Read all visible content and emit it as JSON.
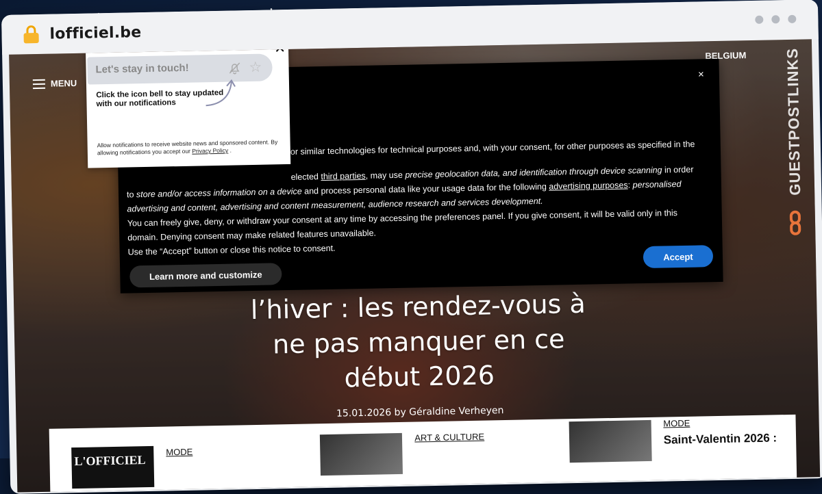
{
  "browser": {
    "url": "lofficiel.be",
    "window_dot_colors": [
      "#b7bbc2",
      "#b7bbc2",
      "#b7bbc2"
    ]
  },
  "site": {
    "menu_label": "MENU",
    "region": "BELGIUM"
  },
  "hero": {
    "title_lines": [
      "l’hiver : les rendez-vous à",
      "ne pas manquer en ce",
      "début 2026"
    ],
    "meta": "15.01.2026 by Géraldine Verheyen"
  },
  "consent": {
    "close_label": "×",
    "line_1": "or similar technologies for technical purposes and, with your consent, for other purposes as specified in the",
    "line_2_a": "elected ",
    "line_2_link": "third parties",
    "line_2_b": ", may use ",
    "line_2_italic": "precise geolocation data, and identification through device scanning",
    "line_2_c": " in order",
    "line_3_a": "to ",
    "line_3_italic": "store and/or access information on a device",
    "line_3_b": " and process personal data like your usage data for the following ",
    "line_3_link": "advertising purposes",
    "line_3_c": ": ",
    "line_3_italic_2": "personalised",
    "line_4_italic": "advertising and content, advertising and content measurement, audience research and services development.",
    "line_5": "You can freely give, deny, or withdraw your consent at any time by accessing the preferences panel. If you give consent, it will be valid only in this",
    "line_6": "domain. Denying consent may make related features unavailable.",
    "line_7": "Use the “Accept” button or close this notice to consent.",
    "learn_more_label": "Learn more and customize",
    "accept_label": "Accept",
    "accept_color": "#1a6fd1"
  },
  "notification": {
    "close_label": "✕",
    "title": "Let's stay in touch!",
    "body": "Click the icon bell to stay updated with our notifications",
    "footer": "Allow notifications to receive website news and sponsored content. By allowing notifications you accept our ",
    "footer_link": "Privacy Policy",
    "footer_end": " .",
    "icons": [
      "bell-off-icon",
      "star-icon"
    ]
  },
  "watermark": {
    "text": "GUESTPOSTLINKS",
    "accent_color": "#e8743b"
  },
  "cards": [
    {
      "category": "MODE",
      "title": "",
      "thumb_text": "L'OFFICIEL"
    },
    {
      "category": "ART & CULTURE",
      "title": ""
    },
    {
      "category": "MODE",
      "title": "Saint-Valentin 2026 :"
    }
  ]
}
